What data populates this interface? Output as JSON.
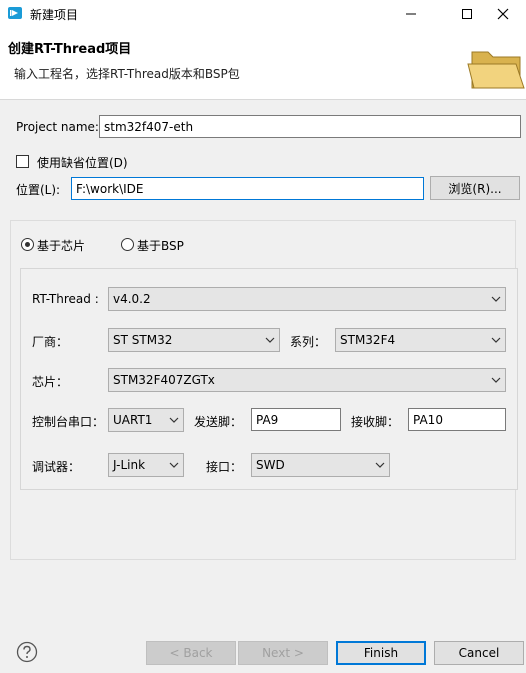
{
  "window": {
    "title": "新建项目",
    "controls": [
      "minimize",
      "maximize",
      "close"
    ]
  },
  "header": {
    "title": "创建RT-Thread项目",
    "description": "输入工程名，选择RT-Thread版本和BSP包"
  },
  "project": {
    "name_label": "Project name:",
    "name_value": "stm32f407-eth"
  },
  "location": {
    "use_default_label": "使用缺省位置(D)",
    "use_default_checked": false,
    "path_label": "位置(L):",
    "path_value": "F:\\work\\IDE",
    "browse_label": "浏览(R)..."
  },
  "mode": {
    "chip_label": "基于芯片",
    "bsp_label": "基于BSP",
    "selected": "chip"
  },
  "config": {
    "rtthread_label": "RT-Thread :",
    "rtthread_value": "v4.0.2",
    "vendor_label": "厂商：",
    "vendor_value": "ST STM32",
    "series_label": "系列：",
    "series_value": "STM32F4",
    "chip_label": "芯片：",
    "chip_value": "STM32F407ZGTx",
    "console_label": "控制台串口：",
    "console_value": "UART1",
    "tx_label": "发送脚：",
    "tx_value": "PA9",
    "rx_label": "接收脚：",
    "rx_value": "PA10",
    "debugger_label": "调试器：",
    "debugger_value": "J-Link",
    "interface_label": "接口：",
    "interface_value": "SWD"
  },
  "footer": {
    "back_label": "< Back",
    "next_label": "Next >",
    "finish_label": "Finish",
    "cancel_label": "Cancel"
  },
  "colors": {
    "accent": "#0078d7",
    "window_bg": "#f0f0f0",
    "folder": "#e8c66a"
  }
}
